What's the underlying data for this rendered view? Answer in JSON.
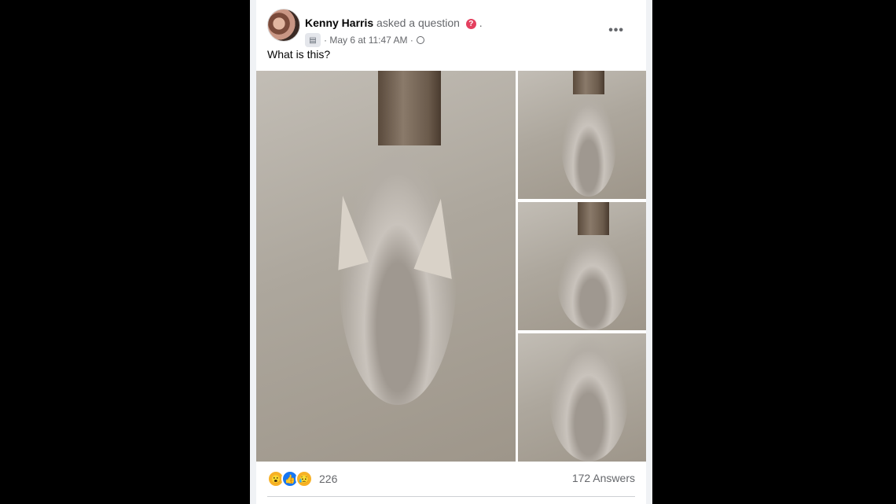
{
  "post": {
    "author": "Kenny Harris",
    "action": "asked a question",
    "question_icon": "?",
    "trailing_dot": ".",
    "timestamp": "May 6 at 11:47 AM",
    "separator": "·",
    "more": "•••",
    "caption": "What is this?"
  },
  "icons": {
    "question": "question-icon",
    "group": "group-icon",
    "globe": "globe-icon",
    "more": "more-options-icon",
    "reactions": [
      "wow-icon",
      "like-icon",
      "sad-icon"
    ]
  },
  "reaction_glyphs": [
    "😮",
    "👍",
    "😥"
  ],
  "footer": {
    "reaction_count": "226",
    "answers": "172 Answers"
  },
  "colors": {
    "like": "#1877f2",
    "question": "#e4405f",
    "text_secondary": "#65676b"
  }
}
